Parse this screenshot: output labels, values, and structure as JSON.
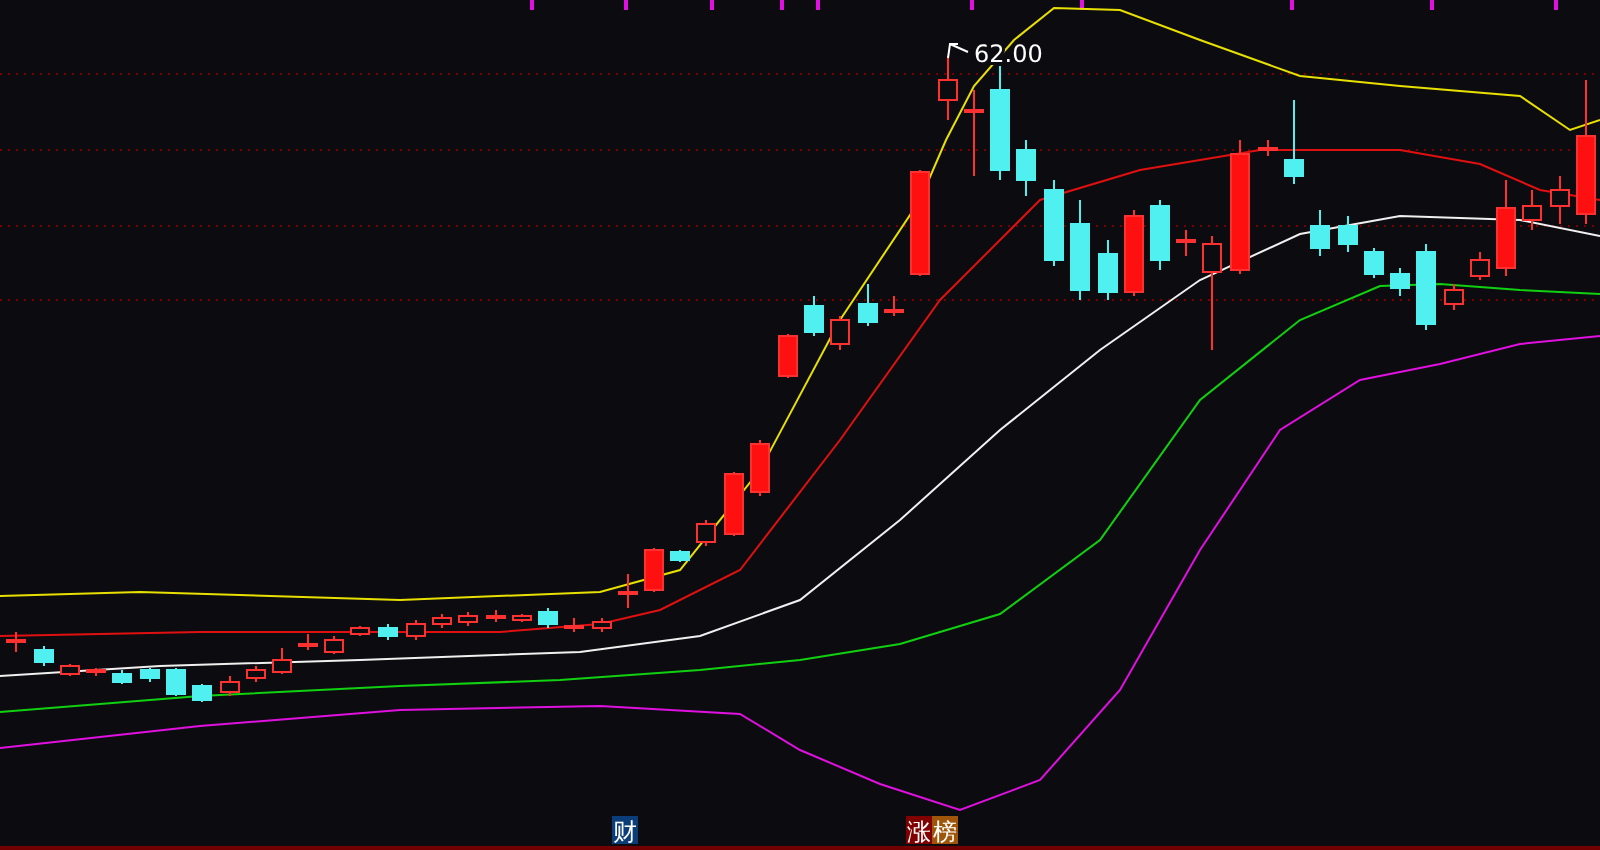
{
  "chart": {
    "price_label": "62.00"
  },
  "badges": [
    {
      "text": "财",
      "color": "#0b3d78"
    },
    {
      "text": "涨",
      "color": "#800000"
    },
    {
      "text": "榜",
      "color": "#a0560a"
    }
  ]
}
